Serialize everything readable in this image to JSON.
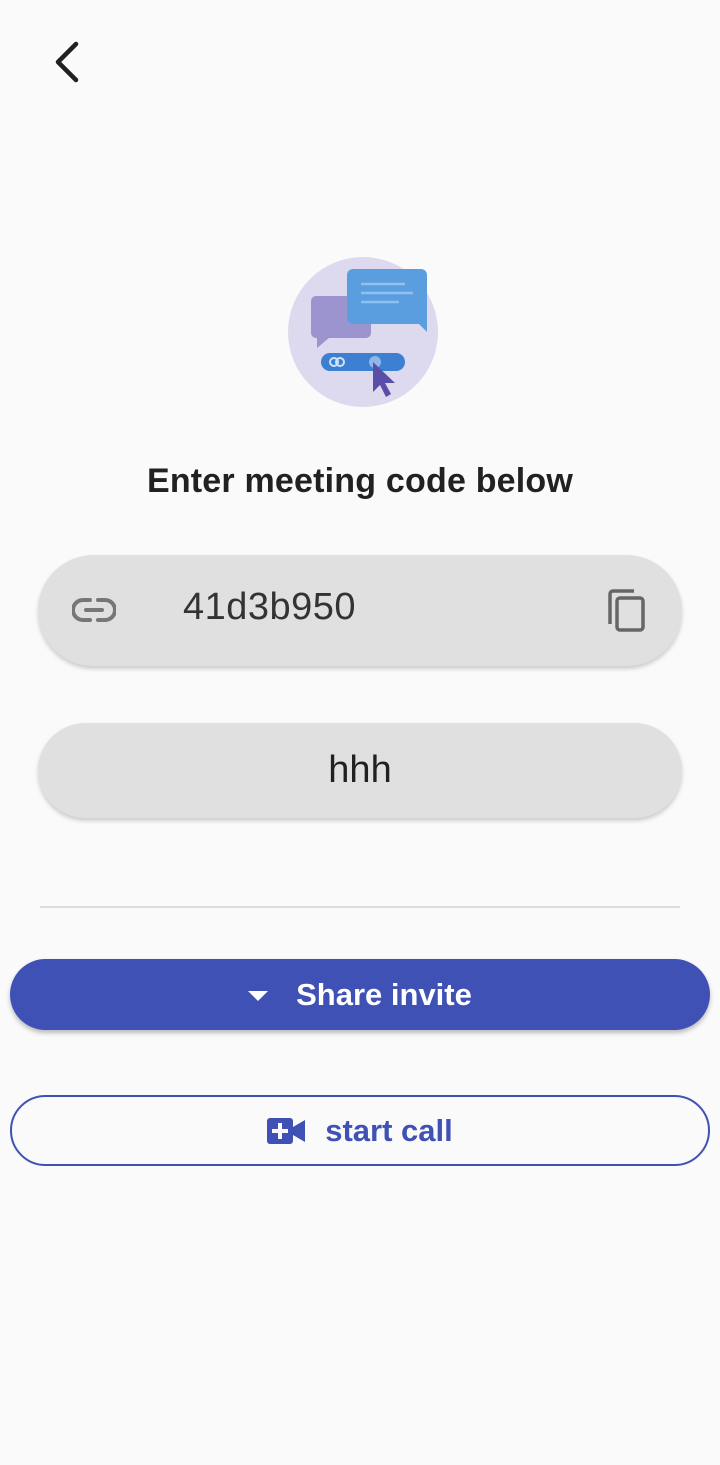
{
  "header": {
    "back_icon": "chevron-left-icon"
  },
  "illustration": {
    "icon": "chat-bubbles-link-illustration"
  },
  "heading": "Enter meeting code below",
  "code_field": {
    "leading_icon": "link-icon",
    "value": "41d3b950",
    "trailing_icon": "copy-icon"
  },
  "name_field": {
    "value": "hhh"
  },
  "actions": {
    "share_label": "Share invite",
    "share_icon": "caret-down-icon",
    "start_label": "start call",
    "start_icon": "video-add-icon"
  },
  "colors": {
    "accent": "#3f51b5",
    "field_bg": "#e0e0e0",
    "page_bg": "#fafafa"
  }
}
